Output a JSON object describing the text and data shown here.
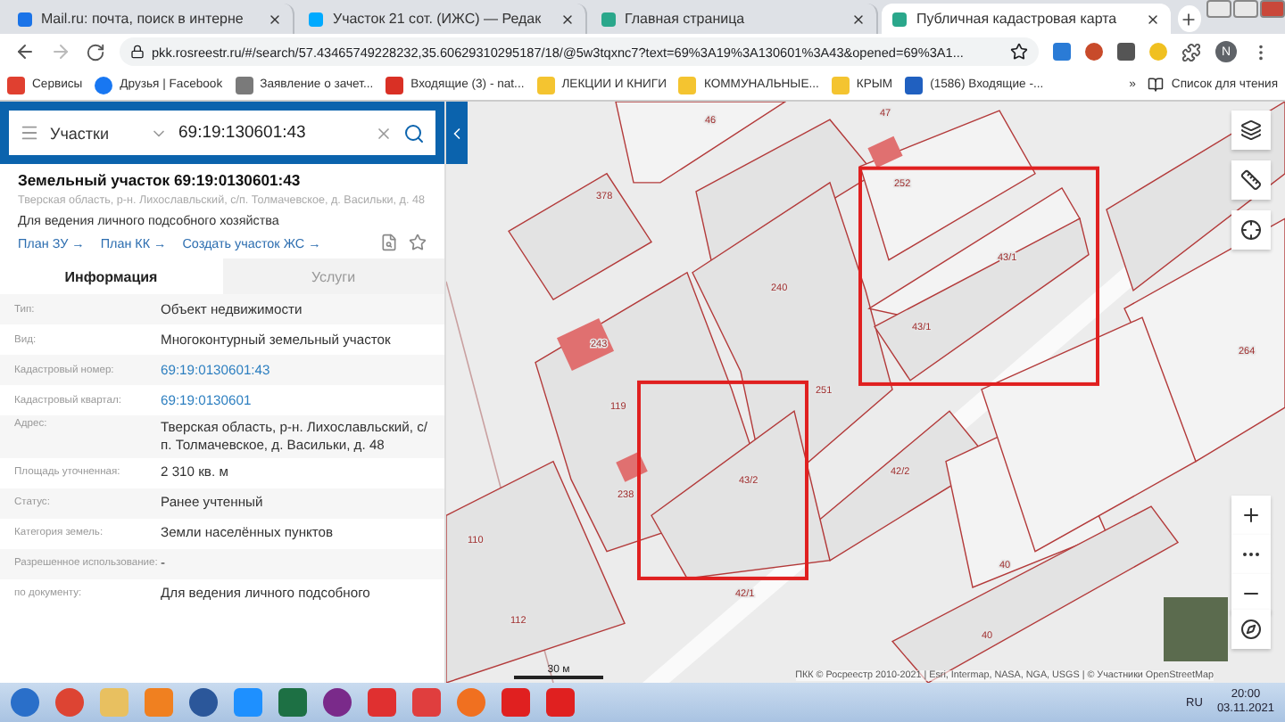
{
  "browser": {
    "tabs": [
      {
        "title": "Mail.ru: почта, поиск в интерне",
        "selected": false
      },
      {
        "title": "Участок 21 сот. (ИЖС) — Редак",
        "selected": false
      },
      {
        "title": "Главная страница",
        "selected": false
      },
      {
        "title": "Публичная кадастровая карта",
        "selected": true
      }
    ],
    "url": "pkk.rosreestr.ru/#/search/57.43465749228232,35.60629310295187/18/@5w3tqxnc7?text=69%3A19%3A130601%3A43&opened=69%3A1...",
    "profile": "N",
    "bookmarks": [
      "Сервисы",
      "Друзья | Facebook",
      "Заявление о зачет...",
      "Входящие (3) - nat...",
      "ЛЕКЦИИ И КНИГИ",
      "КОММУНАЛЬНЫЕ...",
      "КРЫМ",
      "(1586) Входящие -..."
    ],
    "more": "»",
    "reading_list": "Список для чтения"
  },
  "search": {
    "layer": "Участки",
    "value": "69:19:130601:43"
  },
  "card": {
    "title": "Земельный участок 69:19:0130601:43",
    "address": "Тверская область, р-н. Лихославльский, с/п. Толмачевское, д. Васильки, д. 48",
    "purpose": "Для ведения личного подсобного хозяйства",
    "links": [
      "План ЗУ →",
      "План КК →",
      "Создать участок ЖС →"
    ]
  },
  "tabs": [
    {
      "label": "Информация",
      "selected": true
    },
    {
      "label": "Услуги",
      "selected": false
    }
  ],
  "rows": [
    {
      "label": "Тип:",
      "value": "Объект недвижимости",
      "kind": "text"
    },
    {
      "label": "Вид:",
      "value": "Многоконтурный земельный участок",
      "kind": "text"
    },
    {
      "label": "Кадастровый номер:",
      "value": "69:19:0130601:43",
      "kind": "link"
    },
    {
      "label": "Кадастровый квартал:",
      "value": "69:19:0130601",
      "kind": "link"
    },
    {
      "label": "Адрес:",
      "value": "Тверская область, р-н. Лихославльский, с/п. Толмачевское, д. Васильки, д. 48",
      "kind": "text"
    },
    {
      "label": "Площадь уточненная:",
      "value": "2 310 кв. м",
      "kind": "text"
    },
    {
      "label": "Статус:",
      "value": "Ранее учтенный",
      "kind": "text"
    },
    {
      "label": "Категория земель:",
      "value": "Земли населённых пунктов",
      "kind": "text"
    },
    {
      "label": "Разрешенное использование:",
      "value": "-",
      "kind": "text"
    },
    {
      "label": "по документу:",
      "value": "Для ведения личного подсобного",
      "kind": "text"
    }
  ],
  "map": {
    "labels": [
      "46",
      "47",
      "378",
      "252",
      "240",
      "43/1",
      "43/1",
      "243",
      "119",
      "251",
      "43/2",
      "42/2",
      "238",
      "110",
      "42/1",
      "112",
      "40",
      "40",
      "264"
    ],
    "scale": "30 м",
    "attribution": "ПКК © Росреестр 2010-2021 | Esri, Intermap, NASA, NGA, USGS | © Участники OpenStreetMap"
  },
  "taskbar": {
    "language": "RU",
    "time": "20:00",
    "date": "03.11.2021"
  }
}
